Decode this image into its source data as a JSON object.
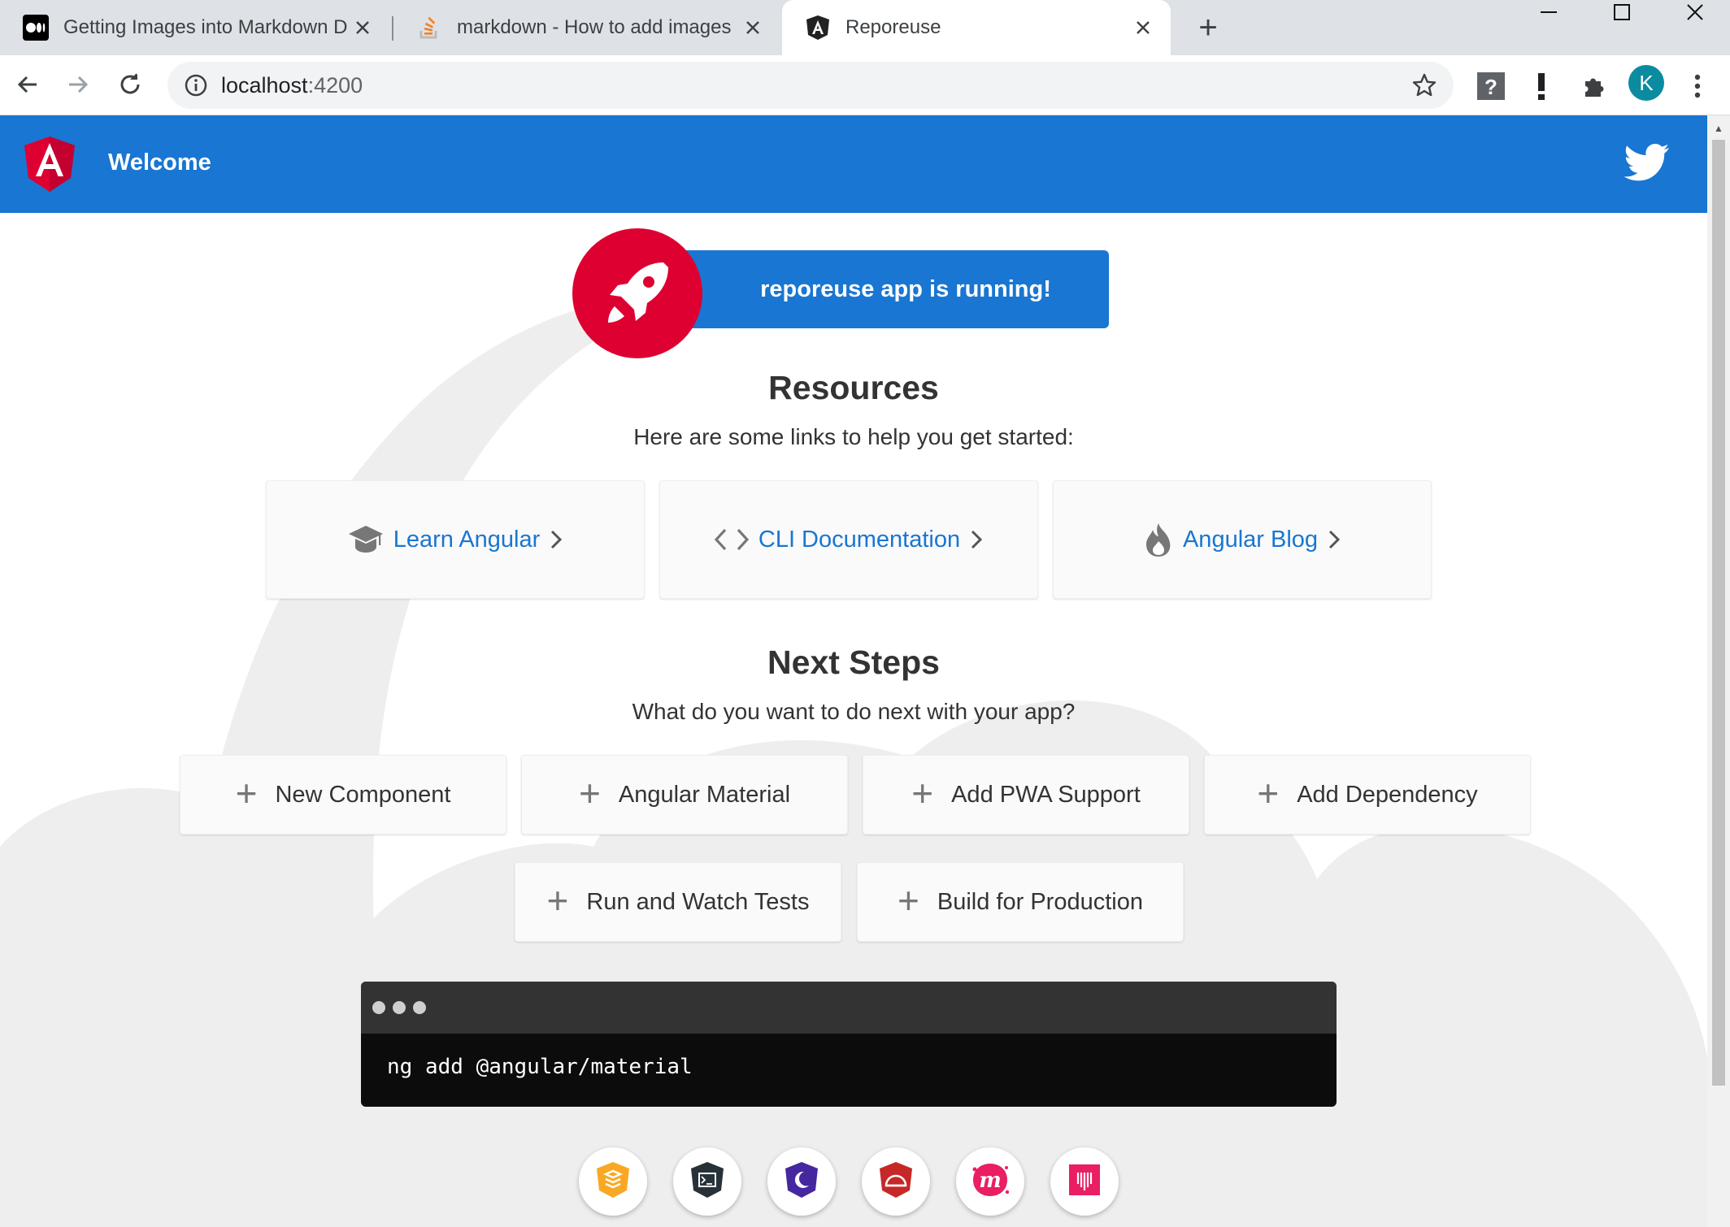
{
  "browser": {
    "tabs": [
      {
        "title": "Getting Images into Markdown D",
        "icon": "medium-icon",
        "active": false
      },
      {
        "title": "markdown - How to add images",
        "icon": "stackoverflow-icon",
        "active": false
      },
      {
        "title": "Reporeuse",
        "icon": "angular-icon",
        "active": true
      }
    ],
    "new_tab": "+",
    "address": {
      "host": "localhost",
      "port": ":4200"
    },
    "avatar_letter": "K"
  },
  "app": {
    "header": {
      "title": "Welcome"
    },
    "running_message": "reporeuse app is running!",
    "resources": {
      "title": "Resources",
      "subtitle": "Here are some links to help you get started:",
      "cards": [
        {
          "label": "Learn Angular",
          "icon": "graduation-cap-icon"
        },
        {
          "label": "CLI Documentation",
          "icon": "code-brackets-icon"
        },
        {
          "label": "Angular Blog",
          "icon": "flame-icon"
        }
      ]
    },
    "next_steps": {
      "title": "Next Steps",
      "subtitle": "What do you want to do next with your app?",
      "cards": [
        {
          "label": "New Component"
        },
        {
          "label": "Angular Material"
        },
        {
          "label": "Add PWA Support"
        },
        {
          "label": "Add Dependency"
        },
        {
          "label": "Run and Watch Tests"
        },
        {
          "label": "Build for Production"
        }
      ]
    },
    "terminal_command": "ng add @angular/material",
    "footer_links": [
      {
        "icon": "animations-icon",
        "color": "#f9a825"
      },
      {
        "icon": "cli-icon",
        "color": "#263238"
      },
      {
        "icon": "augury-icon",
        "color": "#4527a0"
      },
      {
        "icon": "protractor-icon",
        "color": "#c62828"
      },
      {
        "icon": "meetup-icon",
        "color": "#e91e63"
      },
      {
        "icon": "discord-icon",
        "color": "#e91e63"
      }
    ],
    "colors": {
      "brand_blue": "#1976d2",
      "angular_red": "#dd0031"
    }
  }
}
